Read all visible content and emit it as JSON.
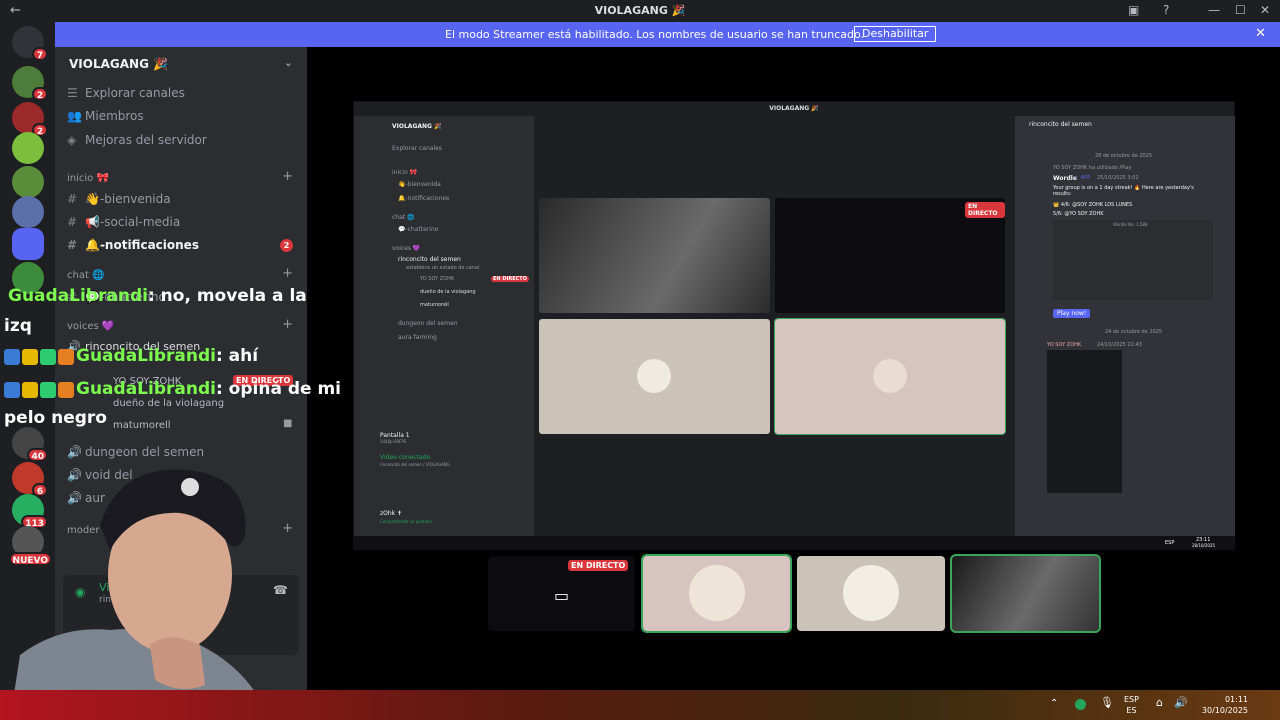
{
  "window": {
    "title": "VIOLAGANG 🎉",
    "back_icon": "back-arrow-icon"
  },
  "banner": {
    "message": "El modo Streamer está habilitado. Los nombres de usuario se han truncado.",
    "button": "Deshabilitar"
  },
  "guild_badges": [
    "7",
    "2",
    "2",
    "40",
    "6",
    "113",
    "NUEVO"
  ],
  "sidebar": {
    "server_name": "VIOLAGANG 🎉",
    "items": [
      {
        "label": "Explorar canales"
      },
      {
        "label": "Miembros"
      },
      {
        "label": "Mejoras del servidor"
      }
    ],
    "cat_inicio": "inicio 🎀",
    "channels_inicio": [
      "👋-bienvenida",
      "📢-social-media",
      "🔔-notificaciones"
    ],
    "notif_count": "2",
    "cat_chat": "chat 🌐",
    "channel_chat": "💬-chatterino",
    "cat_voices": "voices 💜",
    "voice_channel": "rinconcito del semen",
    "live_label": "EN DIRECTO",
    "users": [
      "YO SOY ZOHK",
      "dueño de la violagang",
      "matumorell"
    ],
    "more_voice": [
      "dungeon del semen",
      "void del",
      "aur"
    ],
    "cat_moder": "moder",
    "voice_connected": "Video con",
    "voice_sub": "rinconcit"
  },
  "overlay_chat": [
    {
      "name": "GuadaLibrandi",
      "text": ": no, movela a la"
    },
    {
      "name": "",
      "text": "izq"
    },
    {
      "name": "GuadaLibrandi",
      "text": ": ahí"
    },
    {
      "name": "GuadaLibrandi",
      "text": ": opiná de mi"
    },
    {
      "name": "",
      "text": "pelo negro"
    }
  ],
  "embed": {
    "title": "VIOLAGANG 🎉",
    "server_name": "VIOLAGANG 🎉",
    "explore": "Explorar canales",
    "cat_inicio": "inicio 🎀",
    "ch1": "👋-bienvenida",
    "ch2": "🔔-notificaciones",
    "cat_chat": "chat 🌐",
    "ch3": "💬-chatterino",
    "cat_voices": "voices 💜",
    "voice": "rinconcito del semen",
    "voice_status": "establece un estado de canal",
    "u1": "YO SOY ZOHK",
    "u2": "dueño de la violagang",
    "u3": "matumorell",
    "v2": "dungeon del semen",
    "v3": "aura farming",
    "screen": "Pantalla 1",
    "screen_sub": "1440p 60FPS",
    "connected": "Vídeo conectado",
    "connected_sub": "rinconcito del semen / VIOLAGANG",
    "user": "zOhk ✝",
    "user_status": "Compartiendo su pantalla",
    "right_channel": "rinconcito del semen",
    "date1": "28 de octubre de 2025",
    "used_by": "YO SOY ZOHK ha utilizado /Play",
    "bot": "Wordle",
    "bot_tag": "✓ APP",
    "bot_time": "25/10/2025 3:02",
    "streak": "Your group is on a 1 day streak! 🔥 Here are yesterday's results:",
    "r1": "👑 4/6: @SOY ZOHK LOS LUNES",
    "r2": "5/6: @YO SOY ZOHK",
    "wordle_no": "Wordle No. 1,588",
    "play": "Play now!",
    "date2": "24 de octubre de 2025",
    "poster": "YO SOY ZOHK",
    "post_time": "24/10/2025 22:43",
    "clock": "23:11",
    "clock_date": "28/10/2025",
    "lang": "ESP"
  },
  "live_badge": "EN DIRECTO",
  "system_tray": {
    "lang1": "ESP",
    "lang2": "ES",
    "time": "01:11",
    "date": "30/10/2025"
  }
}
